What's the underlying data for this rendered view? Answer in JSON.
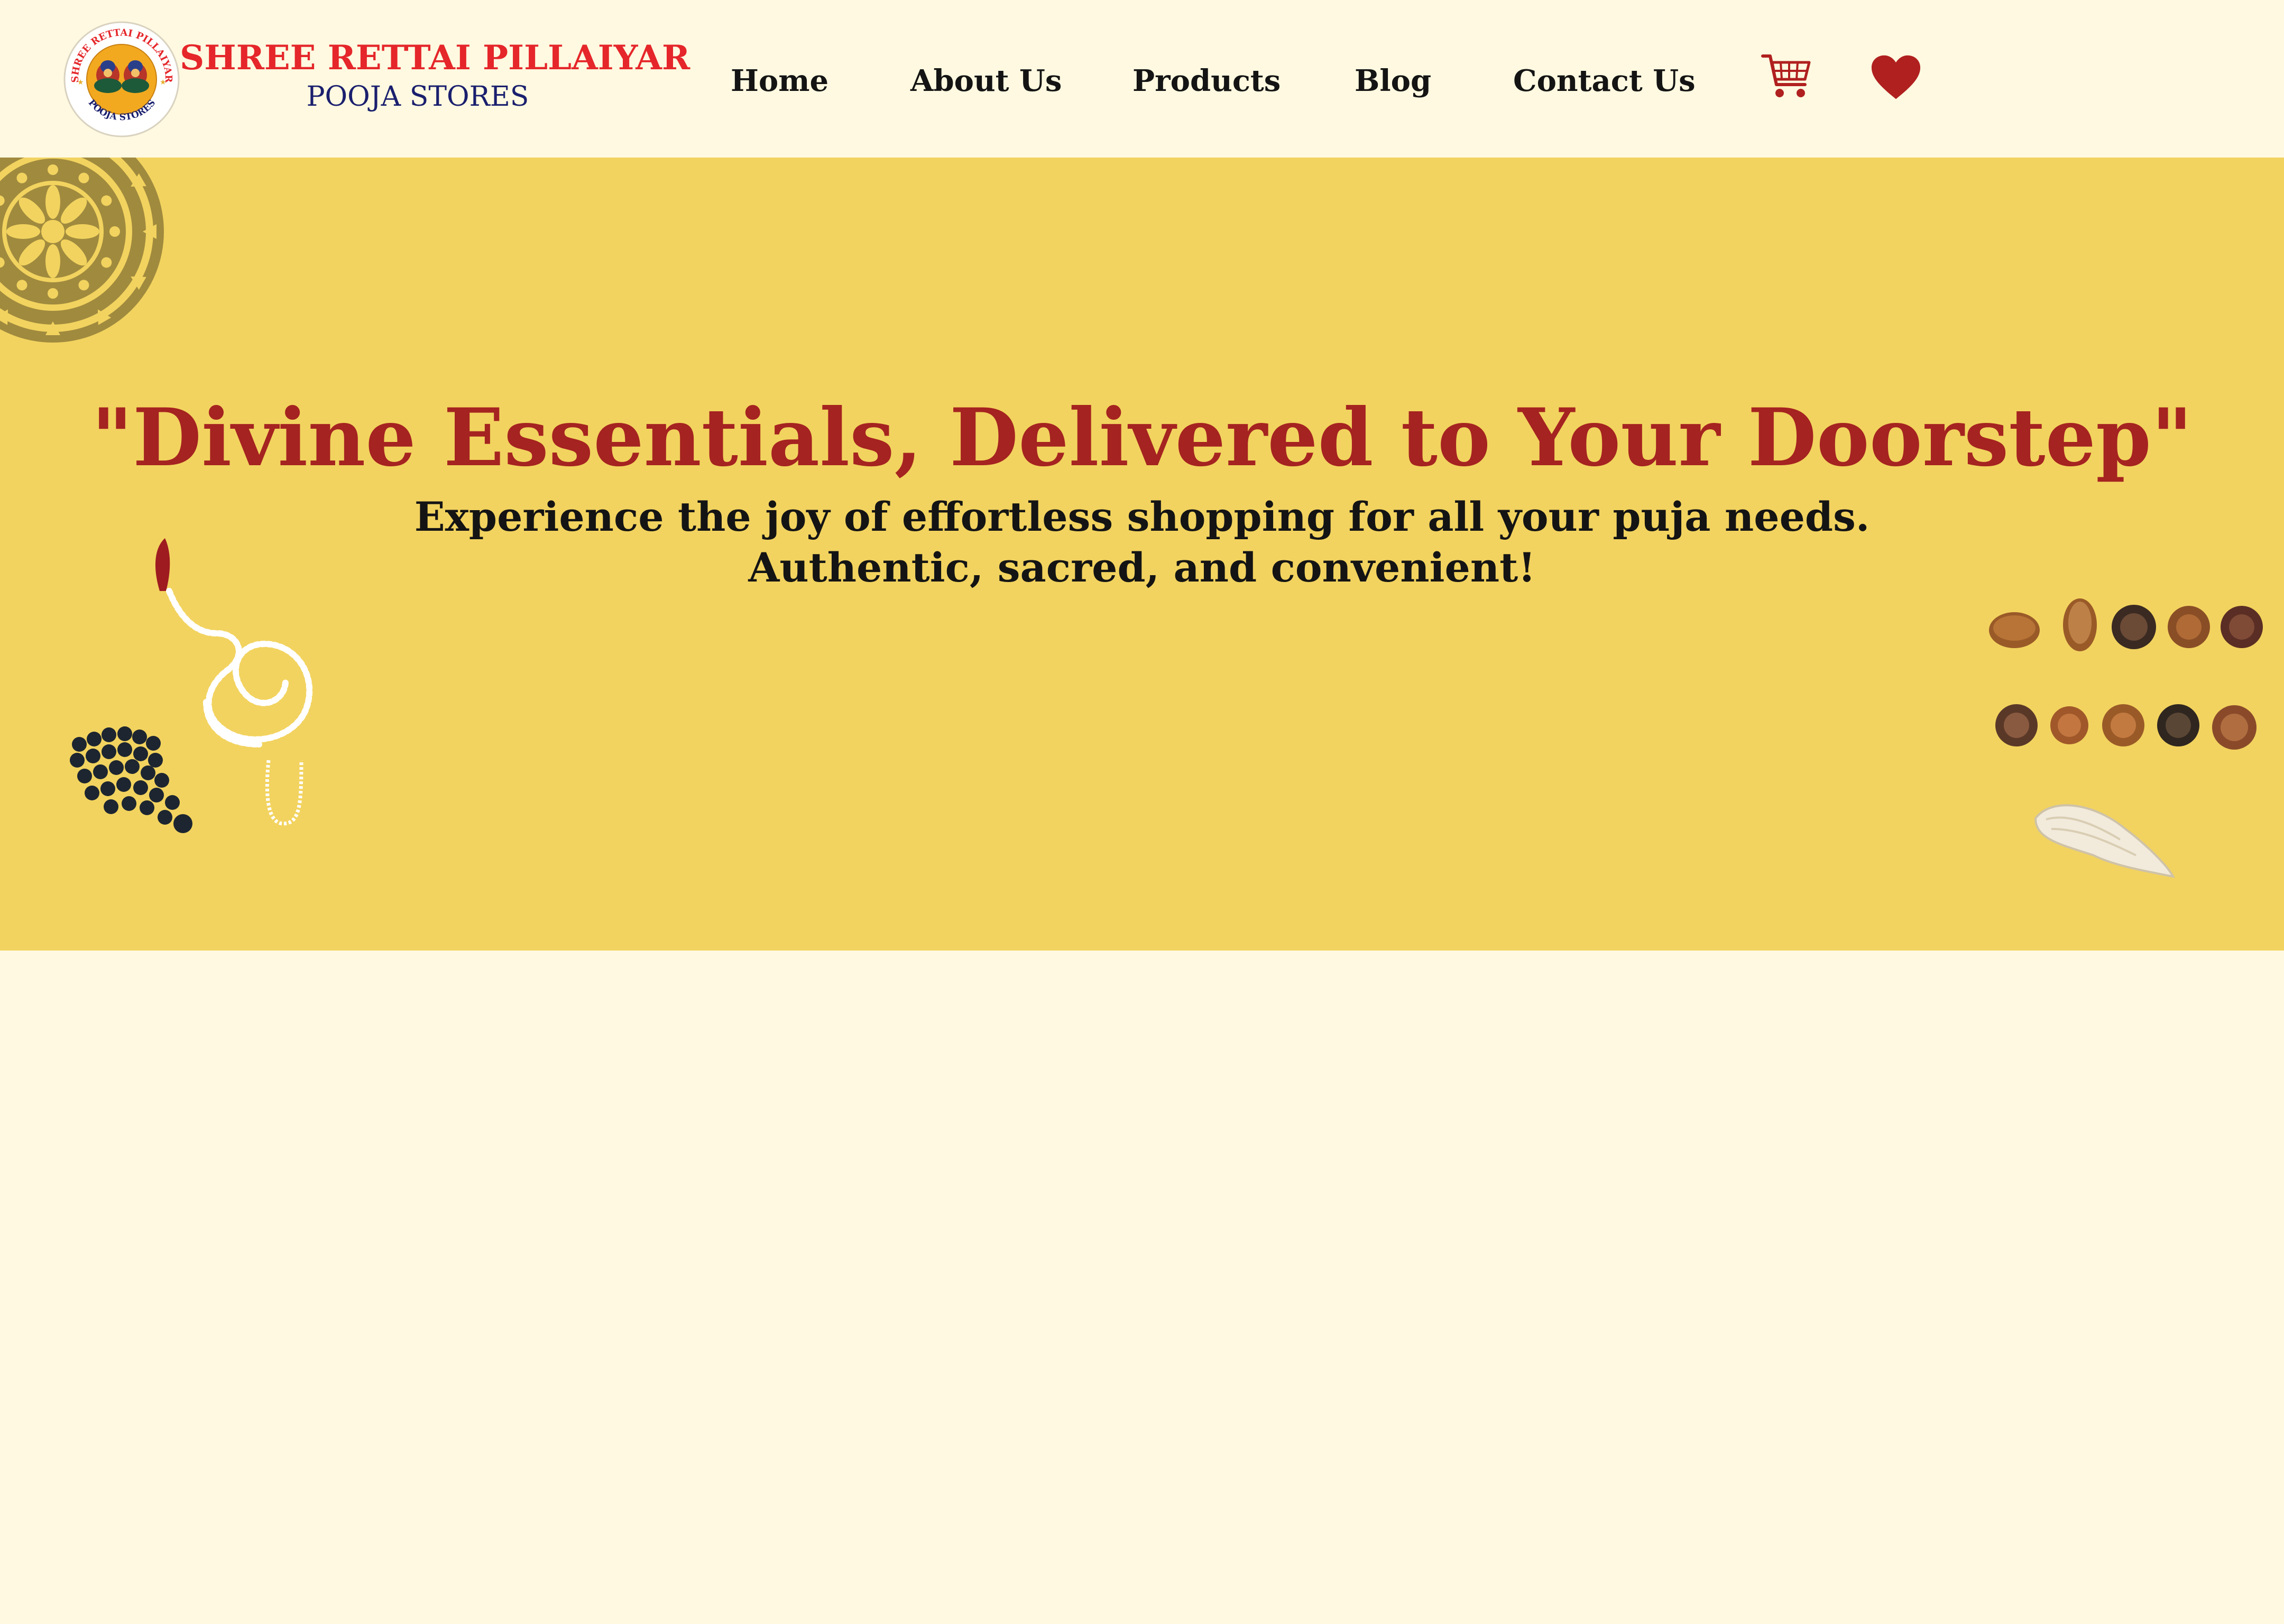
{
  "header": {
    "brand_name": "SHREE RETTAI PILLAIYAR",
    "brand_sub": "POOJA STORES",
    "logo_ring_top": "SHREE RETTAI PILLAIYAR",
    "logo_ring_bottom": "POOJA STORES",
    "nav": [
      {
        "label": "Home"
      },
      {
        "label": "About Us"
      },
      {
        "label": "Products"
      },
      {
        "label": "Blog"
      },
      {
        "label": "Contact Us"
      }
    ],
    "icons": {
      "cart": "shopping-cart-icon",
      "wishlist": "heart-icon"
    }
  },
  "hero": {
    "headline": "\"Divine Essentials, Delivered to Your Doorstep\"",
    "subline_1": "Experience the joy of effortless shopping for all your puja needs.",
    "subline_2": "Authentic, sacred, and convenient!"
  },
  "colors": {
    "page_bg": "#FEF9E0",
    "hero_bg": "#F2D35F",
    "accent_red": "#A52320",
    "brand_red": "#E5262A",
    "brand_navy": "#1A1F6E",
    "icon_red": "#B0201F"
  }
}
